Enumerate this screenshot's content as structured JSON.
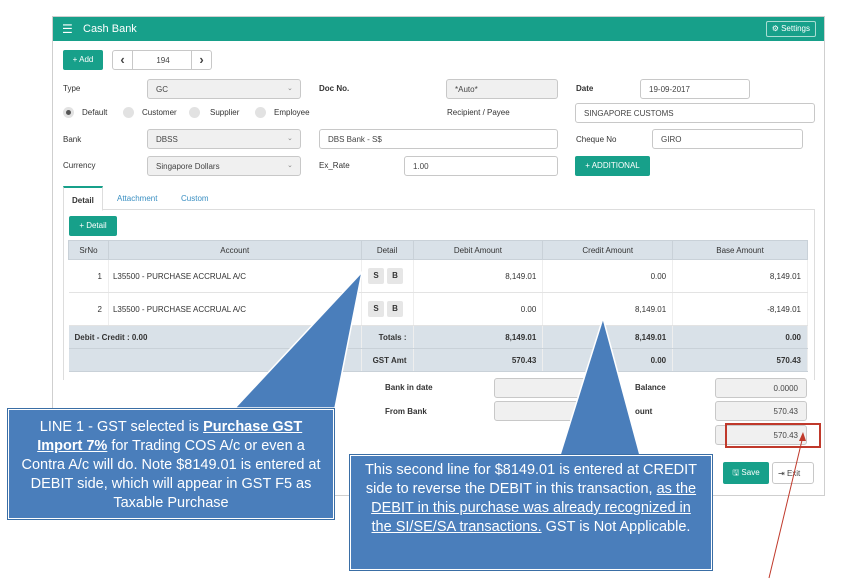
{
  "window": {
    "title": "Cash Bank",
    "settings_label": "Settings"
  },
  "toolbar": {
    "add_label": "+ Add",
    "record_number": "194",
    "prev_icon": "‹",
    "next_icon": "›"
  },
  "form": {
    "type_label": "Type",
    "type_value": "GC",
    "doc_no_label": "Doc No.",
    "doc_no_value": "*Auto*",
    "date_label": "Date",
    "date_value": "19-09-2017",
    "radio_options": [
      "Default",
      "Customer",
      "Supplier",
      "Employee"
    ],
    "recipient_label": "Recipient / Payee",
    "recipient_value": "SINGAPORE CUSTOMS",
    "bank_label": "Bank",
    "bank_value": "DBSS",
    "bank_name": "DBS Bank - S$",
    "cheque_label": "Cheque No",
    "cheque_value": "GIRO",
    "currency_label": "Currency",
    "currency_value": "Singapore Dollars",
    "ex_rate_label": "Ex_Rate",
    "ex_rate_value": "1.00",
    "additional_label": "+ ADDITIONAL"
  },
  "tabs": [
    "Detail",
    "Attachment",
    "Custom"
  ],
  "detail_button": "+ Detail",
  "grid": {
    "headers": [
      "SrNo",
      "Account",
      "Detail",
      "Debit Amount",
      "Credit Amount",
      "Base Amount"
    ],
    "rows": [
      {
        "srno": "1",
        "account": "L35500 - PURCHASE ACCRUAL A/C",
        "s": "S",
        "b": "B",
        "debit": "8,149.01",
        "credit": "0.00",
        "base": "8,149.01"
      },
      {
        "srno": "2",
        "account": "L35500 - PURCHASE ACCRUAL A/C",
        "s": "S",
        "b": "B",
        "debit": "0.00",
        "credit": "8,149.01",
        "base": "-8,149.01"
      }
    ],
    "diff_label": "Debit - Credit : 0.00",
    "totals_label": "Totals :",
    "totals_debit": "8,149.01",
    "totals_credit": "8,149.01",
    "totals_base": "0.00",
    "gst_label": "GST Amt",
    "gst_debit": "570.43",
    "gst_credit": "0.00",
    "gst_base": "570.43"
  },
  "footer": {
    "bank_in_date_label": "Bank in date",
    "from_bank_label": "From Bank",
    "balance_label": "Balance",
    "balance_value": "0.0000",
    "amount_label": "ount",
    "amount_value": "570.43",
    "total_value": "570.43",
    "save_label": "Save",
    "exit_label": "Exit"
  },
  "callouts": {
    "left_pre": "LINE 1 - GST selected is ",
    "left_bold": "Purchase GST Import 7%",
    "left_post": " for Trading COS A/c or even a Contra A/c will do. Note $8149.01 is entered at DEBIT side, which will appear in GST F5 as Taxable Purchase",
    "right_pre": "This second line for $8149.01 is entered at CREDIT side to reverse the DEBIT in this transaction, ",
    "right_u": "as the DEBIT in this purchase was already recognized in the SI/SE/SA transactions.",
    "right_post": " GST is Not Applicable."
  },
  "colors": {
    "accent": "#17a08a",
    "callout": "#4a7ebb",
    "highlight": "#c0392b"
  }
}
